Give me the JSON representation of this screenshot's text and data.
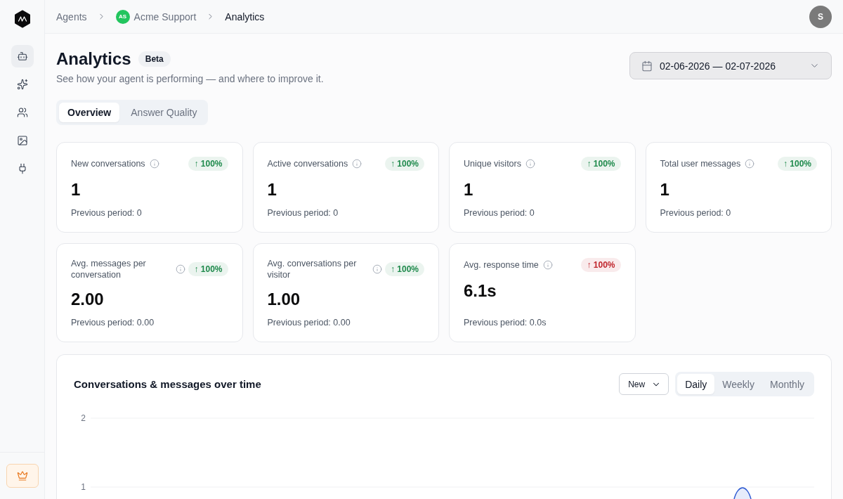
{
  "sidebar": {
    "items": [
      {
        "selected": true
      },
      {
        "selected": false
      },
      {
        "selected": false
      },
      {
        "selected": false
      },
      {
        "selected": false
      }
    ]
  },
  "breadcrumb": [
    {
      "label": "Agents",
      "current": false
    },
    {
      "label": "Acme Support",
      "avatar": "AS",
      "current": false
    },
    {
      "label": "Analytics",
      "current": true
    }
  ],
  "user": {
    "initial": "S"
  },
  "header": {
    "title": "Analytics",
    "badge": "Beta",
    "subtitle": "See how your agent is performing — and where to improve it.",
    "date_range": "02-06-2026 — 02-07-2026"
  },
  "tabs": [
    {
      "label": "Overview",
      "selected": true
    },
    {
      "label": "Answer Quality",
      "selected": false
    }
  ],
  "metrics": [
    {
      "label": "New conversations",
      "change": "↑ 100%",
      "color": "#1f8a4c",
      "value": "1",
      "previous": "Previous period: 0"
    },
    {
      "label": "Active conversations",
      "change": "↑ 100%",
      "color": "#1f8a4c",
      "value": "1",
      "previous": "Previous period: 0"
    },
    {
      "label": "Unique visitors",
      "change": "↑ 100%",
      "color": "#1f8a4c",
      "value": "1",
      "previous": "Previous period: 0"
    },
    {
      "label": "Total user messages",
      "change": "↑ 100%",
      "color": "#1f8a4c",
      "value": "1",
      "previous": "Previous period: 0"
    },
    {
      "label": "Avg. messages per conversation",
      "change": "↑ 100%",
      "color": "#1f8a4c",
      "value": "2.00",
      "previous": "Previous period: 0.00"
    },
    {
      "label": "Avg. conversations per visitor",
      "change": "↑ 100%",
      "color": "#1f8a4c",
      "value": "1.00",
      "previous": "Previous period: 0.00"
    },
    {
      "label": "Avg. response time",
      "change": "↑ 100%",
      "color": "#c0262d",
      "value": "6.1s",
      "previous": "Previous period: 0.0s"
    }
  ],
  "chart_panel": {
    "title": "Conversations & messages over time",
    "series_select": "New",
    "periods": [
      {
        "label": "Daily",
        "selected": true
      },
      {
        "label": "Weekly",
        "selected": false
      },
      {
        "label": "Monthly",
        "selected": false
      }
    ],
    "y_axis_labels": [
      "2",
      "1"
    ]
  }
}
